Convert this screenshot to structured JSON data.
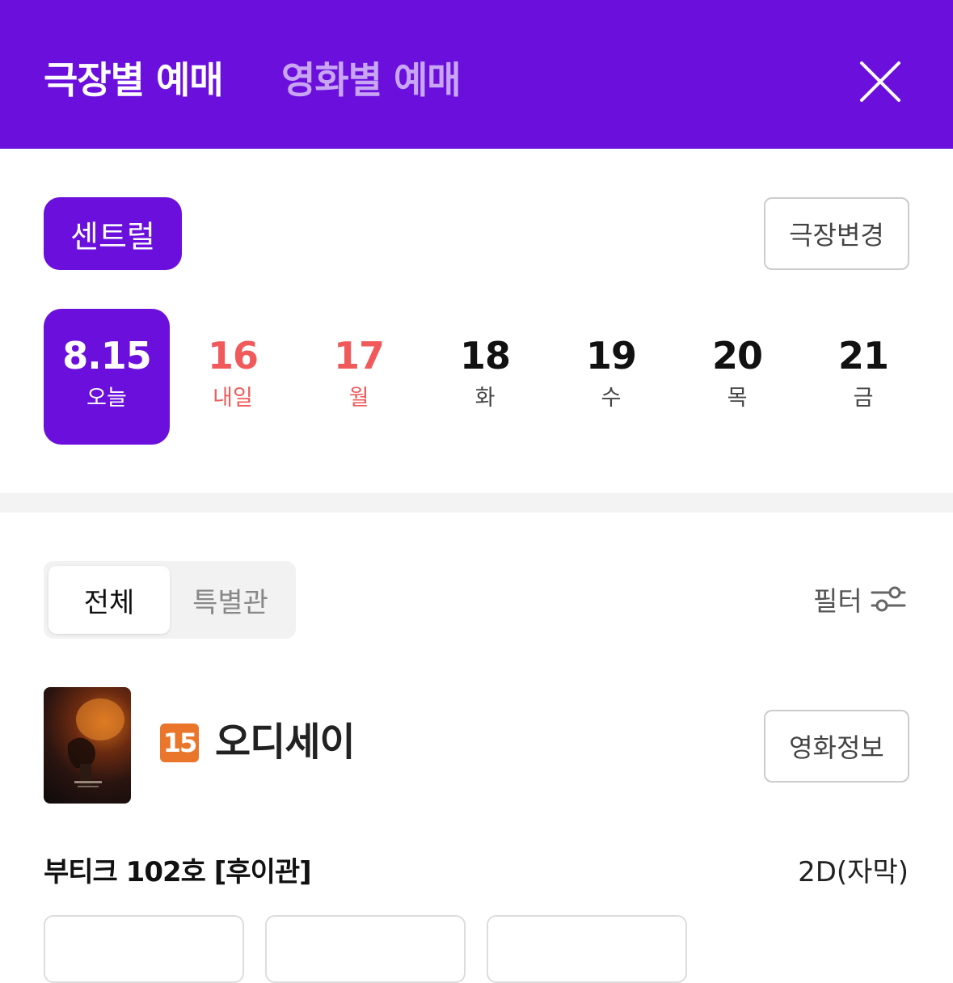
{
  "header": {
    "tabs": [
      {
        "label": "극장별 예매",
        "active": true
      },
      {
        "label": "영화별 예매",
        "active": false
      }
    ],
    "close_icon": "close-icon",
    "background": "#6b0fdc"
  },
  "theater": {
    "selected": "센트럴",
    "change_label": "극장변경"
  },
  "dates": [
    {
      "num": "8.15",
      "day": "오늘",
      "state": "selected"
    },
    {
      "num": "16",
      "day": "내일",
      "state": "holiday"
    },
    {
      "num": "17",
      "day": "월",
      "state": "holiday"
    },
    {
      "num": "18",
      "day": "화",
      "state": "normal"
    },
    {
      "num": "19",
      "day": "수",
      "state": "normal"
    },
    {
      "num": "20",
      "day": "목",
      "state": "normal"
    },
    {
      "num": "21",
      "day": "금",
      "state": "normal"
    }
  ],
  "segment": {
    "all": "전체",
    "special": "특별관"
  },
  "filter": {
    "label": "필터",
    "icon": "sliders-icon"
  },
  "movie": {
    "rating": "15",
    "title": "오디세이",
    "info_label": "영화정보"
  },
  "screening": {
    "hall": "부티크 102호 [후이관]",
    "format": "2D(자막)"
  },
  "colors": {
    "accent": "#6b0fdc",
    "holiday": "#f15a5a",
    "rating": "#e9762b"
  }
}
